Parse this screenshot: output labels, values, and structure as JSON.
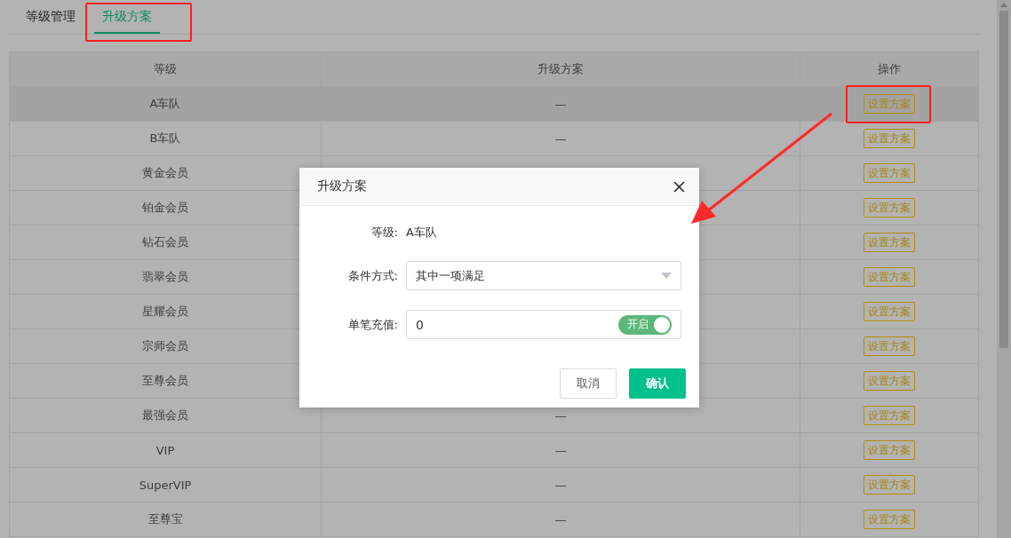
{
  "tabs": [
    {
      "label": "等级管理",
      "selected": false
    },
    {
      "label": "升级方案",
      "selected": true
    }
  ],
  "table": {
    "columns": [
      "等级",
      "升级方案",
      "操作"
    ],
    "rows": [
      {
        "level": "A车队",
        "scheme": "—",
        "action": "设置方案",
        "hovered": true
      },
      {
        "level": "B车队",
        "scheme": "—",
        "action": "设置方案",
        "hovered": false
      },
      {
        "level": "黄金会员",
        "action": "设置方案",
        "hovered": false
      },
      {
        "level": "铂金会员",
        "action": "设置方案",
        "hovered": false
      },
      {
        "level": "钻石会员",
        "action": "设置方案",
        "hovered": false
      },
      {
        "level": "翡翠会员",
        "action": "设置方案",
        "hovered": false
      },
      {
        "level": "星耀会员",
        "action": "设置方案",
        "hovered": false
      },
      {
        "level": "宗师会员",
        "action": "设置方案",
        "hovered": false
      },
      {
        "level": "至尊会员",
        "action": "设置方案",
        "hovered": false
      },
      {
        "level": "最强会员",
        "scheme": "—",
        "action": "设置方案",
        "hovered": false
      },
      {
        "level": "VIP",
        "scheme": "—",
        "action": "设置方案",
        "hovered": false
      },
      {
        "level": "SuperVIP",
        "scheme": "—",
        "action": "设置方案",
        "hovered": false
      },
      {
        "level": "至尊宝",
        "scheme": "—",
        "action": "设置方案",
        "hovered": false
      }
    ]
  },
  "dialog": {
    "title": "升级方案",
    "fields": [
      {
        "kind": "text",
        "label": "等级:",
        "value": "A车队"
      },
      {
        "kind": "select",
        "label": "条件方式:",
        "value": "其中一项满足"
      },
      {
        "kind": "switch-input",
        "label": "单笔充值:",
        "value": "0",
        "switch": {
          "label": "开启",
          "on": true
        }
      }
    ],
    "buttons": [
      {
        "label": "取消",
        "primary": false
      },
      {
        "label": "确认",
        "primary": true
      }
    ]
  }
}
